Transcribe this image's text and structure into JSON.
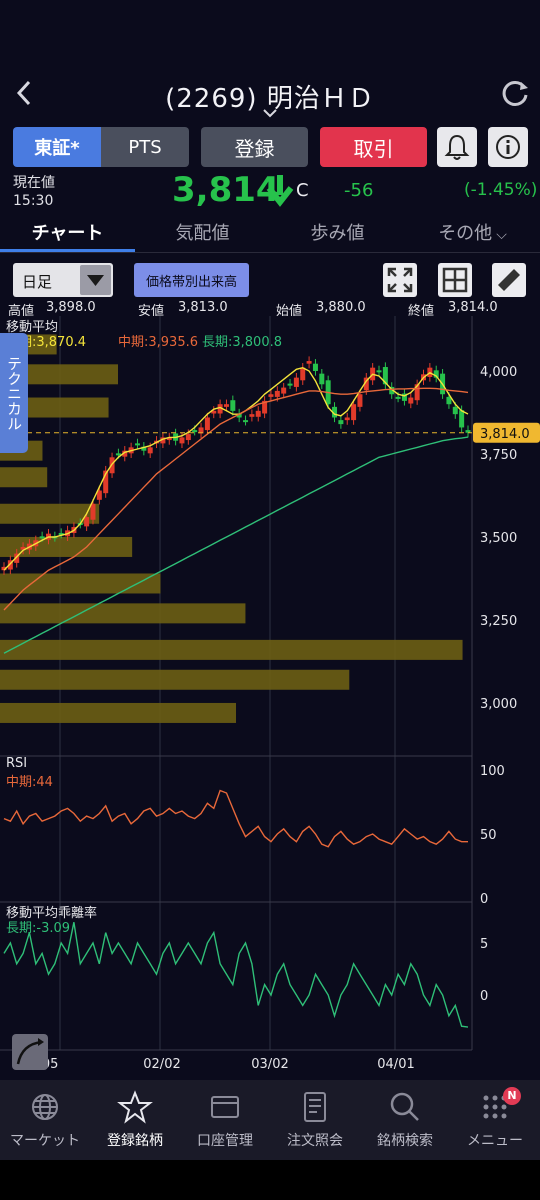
{
  "header": {
    "title": "(2269) 明治ＨＤ"
  },
  "buttons": {
    "tosho": "東証*",
    "pts": "PTS",
    "register": "登録",
    "trade": "取引"
  },
  "price": {
    "label_current": "現在値",
    "time": "15:30",
    "value": "3,814",
    "flag": "C",
    "change": "-56",
    "change_pct": "(-1.45%)"
  },
  "tabs": [
    "チャート",
    "気配値",
    "歩み値",
    "その他"
  ],
  "chart_controls": {
    "period": "日足",
    "volume_by_price": "価格帯別出来高"
  },
  "ohlc": {
    "high_label": "高値",
    "high": "3,898.0",
    "low_label": "安値",
    "low": "3,813.0",
    "open_label": "始値",
    "open": "3,880.0",
    "close_label": "終値",
    "close": "3,814.0"
  },
  "technical_tab": "テクニカル",
  "ma_legend": {
    "title": "移動平均",
    "short": "短期:3,870.4",
    "mid": "中期:3,935.6",
    "long": "長期:3,800.8"
  },
  "rsi": {
    "title": "RSI",
    "mid": "中期:44"
  },
  "deviation": {
    "title": "移動平均乖離率",
    "long": "長期:-3.09"
  },
  "colors": {
    "up": "#e23b2a",
    "down": "#27c24c",
    "short_ma": "#f3e33a",
    "mid_ma": "#e8683a",
    "long_ma": "#2fbf78",
    "volume_bar": "#6b5e14",
    "accent": "#3f7fe8"
  },
  "chart_data": [
    {
      "type": "candlestick",
      "title": "",
      "x_tick_labels": [
        "/05",
        "02/02",
        "03/02",
        "04/01"
      ],
      "y_tick_labels": [
        "4,000",
        "3,750",
        "3,500",
        "3,250",
        "3,000"
      ],
      "ylim": [
        2950,
        4130
      ],
      "last_price_label": "3,814.0",
      "last_price": 3814,
      "close_series": [
        3410,
        3430,
        3450,
        3470,
        3480,
        3490,
        3500,
        3510,
        3500,
        3510,
        3520,
        3530,
        3540,
        3560,
        3600,
        3640,
        3700,
        3740,
        3750,
        3760,
        3770,
        3780,
        3760,
        3770,
        3790,
        3800,
        3800,
        3790,
        3800,
        3810,
        3820,
        3830,
        3860,
        3880,
        3900,
        3900,
        3880,
        3860,
        3850,
        3870,
        3880,
        3910,
        3930,
        3940,
        3950,
        3960,
        3980,
        4010,
        4030,
        4000,
        3960,
        3900,
        3860,
        3840,
        3860,
        3900,
        3930,
        3980,
        4010,
        4000,
        3960,
        3930,
        3920,
        3910,
        3920,
        3960,
        3990,
        4010,
        3980,
        3930,
        3900,
        3870,
        3830,
        3814
      ],
      "series": [
        {
          "name": "短期",
          "values": [
            3400,
            3420,
            3440,
            3460,
            3470,
            3480,
            3490,
            3500,
            3500,
            3505,
            3510,
            3520,
            3540,
            3570,
            3610,
            3650,
            3690,
            3720,
            3740,
            3755,
            3760,
            3765,
            3770,
            3775,
            3785,
            3795,
            3800,
            3800,
            3805,
            3815,
            3830,
            3850,
            3870,
            3885,
            3890,
            3880,
            3870,
            3870,
            3880,
            3895,
            3910,
            3930,
            3945,
            3960,
            3975,
            3990,
            4005,
            4010,
            4000,
            3970,
            3930,
            3890,
            3870,
            3865,
            3880,
            3910,
            3940,
            3970,
            3990,
            3985,
            3965,
            3945,
            3930,
            3925,
            3935,
            3955,
            3980,
            3995,
            3985,
            3960,
            3930,
            3900,
            3880,
            3870.4
          ]
        },
        {
          "name": "中期",
          "values": [
            3280,
            3300,
            3320,
            3340,
            3355,
            3370,
            3385,
            3400,
            3410,
            3420,
            3430,
            3440,
            3455,
            3470,
            3490,
            3510,
            3530,
            3550,
            3570,
            3590,
            3610,
            3630,
            3650,
            3670,
            3690,
            3705,
            3720,
            3735,
            3750,
            3765,
            3780,
            3795,
            3810,
            3825,
            3840,
            3850,
            3860,
            3870,
            3880,
            3890,
            3900,
            3905,
            3910,
            3915,
            3920,
            3925,
            3930,
            3935,
            3940,
            3940,
            3938,
            3935,
            3932,
            3930,
            3930,
            3932,
            3935,
            3938,
            3940,
            3942,
            3944,
            3945,
            3946,
            3946,
            3947,
            3947,
            3948,
            3948,
            3947,
            3945,
            3942,
            3940,
            3938,
            3935.6
          ]
        },
        {
          "name": "長期",
          "values": [
            3150,
            3160,
            3170,
            3180,
            3190,
            3200,
            3210,
            3220,
            3230,
            3240,
            3250,
            3260,
            3270,
            3280,
            3290,
            3300,
            3310,
            3320,
            3330,
            3340,
            3350,
            3360,
            3370,
            3380,
            3390,
            3400,
            3410,
            3420,
            3430,
            3440,
            3450,
            3460,
            3470,
            3480,
            3490,
            3500,
            3510,
            3520,
            3530,
            3540,
            3550,
            3560,
            3570,
            3580,
            3590,
            3600,
            3610,
            3620,
            3630,
            3640,
            3650,
            3660,
            3670,
            3680,
            3690,
            3700,
            3710,
            3720,
            3730,
            3740,
            3745,
            3750,
            3755,
            3760,
            3765,
            3770,
            3775,
            3780,
            3785,
            3790,
            3793,
            3796,
            3798,
            3800.8
          ]
        }
      ],
      "volume_profile_levels": [
        4080,
        3990,
        3890,
        3760,
        3680,
        3570,
        3470,
        3360,
        3270,
        3160,
        3070,
        2970
      ],
      "volume_profile_values": [
        0.12,
        0.25,
        0.23,
        0.09,
        0.1,
        0.21,
        0.28,
        0.34,
        0.52,
        0.98,
        0.74,
        0.5
      ]
    },
    {
      "type": "line",
      "title": "RSI",
      "y_tick_labels": [
        "100",
        "50",
        "0"
      ],
      "ylim": [
        0,
        100
      ],
      "series": [
        {
          "name": "中期",
          "values": [
            62,
            60,
            68,
            58,
            64,
            66,
            60,
            62,
            64,
            68,
            70,
            66,
            60,
            64,
            62,
            66,
            72,
            60,
            64,
            66,
            58,
            62,
            68,
            70,
            64,
            66,
            70,
            66,
            68,
            64,
            62,
            66,
            74,
            70,
            84,
            82,
            70,
            58,
            48,
            52,
            56,
            48,
            44,
            50,
            54,
            48,
            44,
            52,
            56,
            50,
            42,
            40,
            48,
            52,
            46,
            42,
            44,
            48,
            50,
            46,
            44,
            42,
            48,
            54,
            50,
            46,
            48,
            44,
            42,
            46,
            52,
            46,
            44,
            44
          ]
        }
      ]
    },
    {
      "type": "line",
      "title": "移動平均乖離率",
      "y_tick_labels": [
        "5",
        "0"
      ],
      "ylim": [
        -4,
        8
      ],
      "series": [
        {
          "name": "長期",
          "values": [
            4,
            5,
            3,
            4,
            6,
            3,
            4,
            2,
            3,
            5,
            4,
            7,
            3,
            4,
            5,
            3,
            6,
            4,
            5,
            4,
            3,
            5,
            4,
            3,
            2,
            4,
            5,
            3,
            4,
            5,
            4,
            3,
            5,
            6,
            3,
            2,
            1,
            4,
            5,
            3,
            -1,
            1,
            0,
            2,
            3,
            1,
            0,
            -1,
            0,
            2,
            1,
            0,
            -2,
            0,
            1,
            3,
            2,
            1,
            0,
            -1,
            1,
            0,
            2,
            1,
            3,
            2,
            0,
            -1,
            1,
            0,
            -2,
            -1,
            -3,
            -3.09
          ]
        }
      ]
    }
  ],
  "nav": [
    {
      "label": "マーケット",
      "icon": "globe-icon"
    },
    {
      "label": "登録銘柄",
      "icon": "star-icon"
    },
    {
      "label": "口座管理",
      "icon": "card-icon"
    },
    {
      "label": "注文照会",
      "icon": "document-icon"
    },
    {
      "label": "銘柄検索",
      "icon": "search-icon"
    },
    {
      "label": "メニュー",
      "icon": "grid-menu-icon"
    }
  ],
  "menu_badge": "N"
}
